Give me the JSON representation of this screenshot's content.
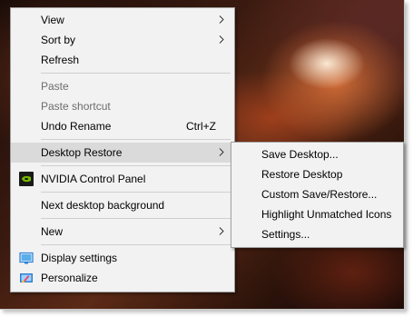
{
  "context_menu": {
    "items": [
      {
        "label": "View",
        "submenu": true
      },
      {
        "label": "Sort by",
        "submenu": true
      },
      {
        "label": "Refresh"
      },
      {
        "label": "Paste",
        "disabled": true
      },
      {
        "label": "Paste shortcut",
        "disabled": true
      },
      {
        "label": "Undo Rename",
        "shortcut": "Ctrl+Z"
      },
      {
        "label": "Desktop Restore",
        "submenu": true,
        "highlighted": true
      },
      {
        "label": "NVIDIA Control Panel",
        "icon": "nvidia-icon"
      },
      {
        "label": "Next desktop background"
      },
      {
        "label": "New",
        "submenu": true
      },
      {
        "label": "Display settings",
        "icon": "display-icon"
      },
      {
        "label": "Personalize",
        "icon": "personalize-icon"
      }
    ]
  },
  "submenu": {
    "items": [
      {
        "label": "Save Desktop..."
      },
      {
        "label": "Restore Desktop"
      },
      {
        "label": "Custom Save/Restore..."
      },
      {
        "label": "Highlight Unmatched Icons"
      },
      {
        "label": "Settings..."
      }
    ]
  },
  "colors": {
    "menu_background": "#f2f2f2",
    "highlight": "#dadada",
    "disabled_text": "#6d6d6d",
    "nvidia_green": "#76b900"
  }
}
